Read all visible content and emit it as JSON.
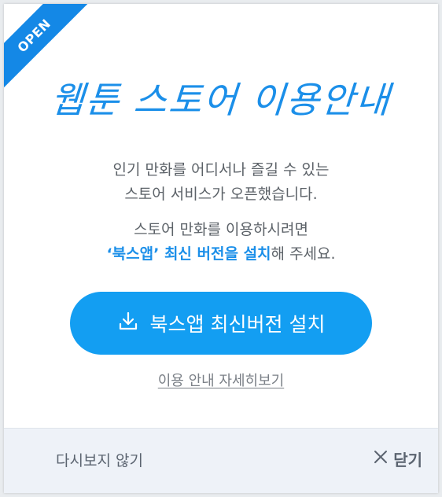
{
  "ribbon": {
    "label": "OPEN"
  },
  "title": "웹툰 스토어 이용안내",
  "description": {
    "line1": "인기 만화를 어디서나 즐길 수 있는",
    "line2": "스토어 서비스가 오픈했습니다.",
    "line3": "스토어 만화를 이용하시려면",
    "line4_highlight": "‘북스앱’ 최신 버전을 설치",
    "line4_rest": "해 주세요."
  },
  "install_button": {
    "label": "북스앱 최신버전 설치",
    "icon": "download-icon"
  },
  "guide_link": "이용 안내 자세히보기",
  "footer": {
    "no_show_label": "다시보지 않기",
    "close_label": "닫기",
    "close_icon": "close-icon"
  },
  "colors": {
    "accent": "#1b8fe9",
    "button": "#139ef2",
    "footer_bg": "#eef2f8"
  }
}
